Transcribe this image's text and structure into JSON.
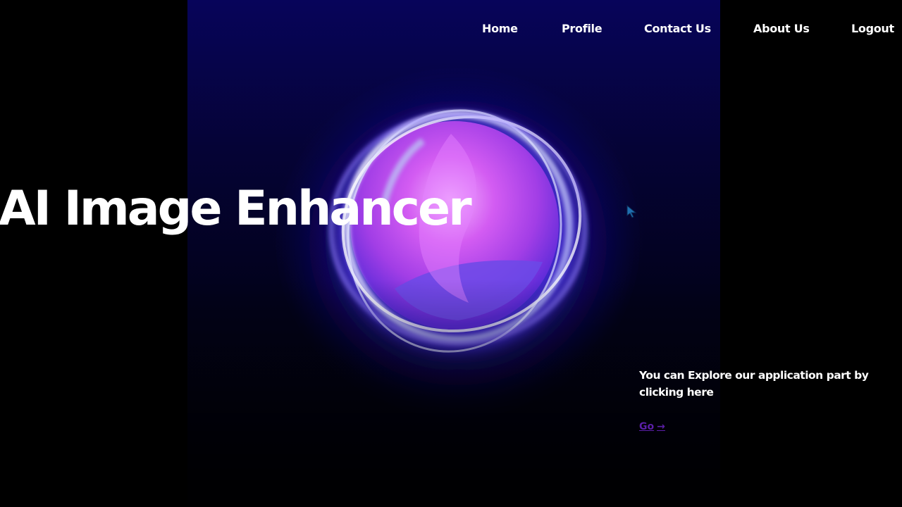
{
  "nav": {
    "items": [
      {
        "label": "Home"
      },
      {
        "label": "Profile"
      },
      {
        "label": "Contact Us"
      },
      {
        "label": "About Us"
      },
      {
        "label": "Logout"
      }
    ]
  },
  "hero": {
    "title": "AI Image Enhancer",
    "explore_text": "You can Explore our application part by clicking here",
    "go_label": "Go",
    "go_arrow": "→"
  },
  "colors": {
    "background": "#000000",
    "text": "#ffffff",
    "go_link": "#5b1fa8",
    "orb_glow": "#3a1fe0",
    "orb_core": "#c84ef0"
  },
  "icons": {
    "cursor": "cursor-arrow-icon",
    "orb": "glowing-orb-graphic"
  }
}
